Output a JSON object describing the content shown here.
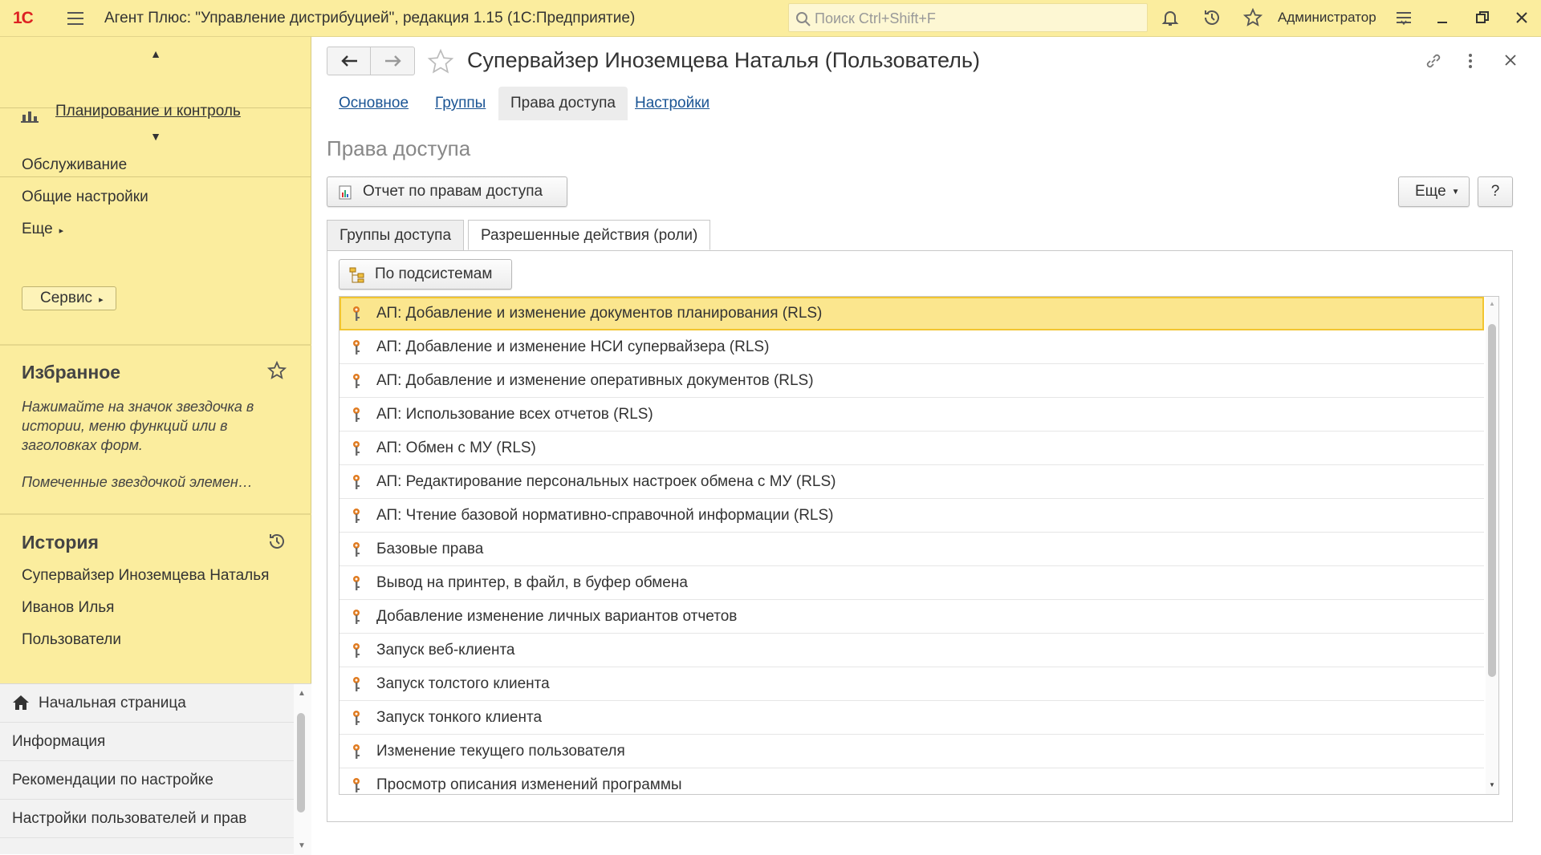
{
  "titlebar": {
    "logo": "1С",
    "app_title": "Агент Плюс: \"Управление дистрибуцией\", редакция 1.15  (1С:Предприятие)",
    "search_placeholder": "Поиск Ctrl+Shift+F",
    "user": "Администратор"
  },
  "sidebar": {
    "sections": [
      {
        "label": "Планирование и контроль"
      }
    ],
    "menu": {
      "service": "Обслуживание",
      "general_settings": "Общие настройки",
      "more": "Еще",
      "servis_button": "Сервис"
    },
    "favorites": {
      "title": "Избранное",
      "hint": "Нажимайте на значок звездочка в истории, меню функций или в заголовках форм.",
      "marked": "Помеченные звездочкой элемен…"
    },
    "history": {
      "title": "История",
      "items": [
        "Супервайзер Иноземцева Наталья",
        "Иванов Илья",
        "Пользователи"
      ]
    },
    "nav": [
      "Начальная страница",
      "Информация",
      "Рекомендации по настройке",
      "Настройки пользователей и прав"
    ]
  },
  "form": {
    "title": "Супервайзер Иноземцева Наталья (Пользователь)",
    "tabs": [
      {
        "label": "Основное",
        "active": false
      },
      {
        "label": "Группы",
        "active": false
      },
      {
        "label": "Права доступа",
        "active": true
      },
      {
        "label": "Настройки",
        "active": false
      }
    ],
    "page_title": "Права доступа",
    "report_button": "Отчет по правам доступа",
    "more_button": "Еще",
    "help_button": "?",
    "panel_tabs": [
      {
        "label": "Группы доступа",
        "active": false
      },
      {
        "label": "Разрешенные действия (роли)",
        "active": true
      }
    ],
    "by_subsystems_button": "По подсистемам",
    "roles": [
      "АП: Добавление и изменение документов планирования (RLS)",
      "АП: Добавление и изменение НСИ супервайзера (RLS)",
      "АП: Добавление и изменение оперативных документов (RLS)",
      "АП: Использование всех отчетов (RLS)",
      "АП: Обмен с МУ (RLS)",
      "АП: Редактирование персональных настроек обмена с МУ (RLS)",
      "АП: Чтение базовой нормативно-справочной информации (RLS)",
      "Базовые права",
      "Вывод на принтер, в файл, в буфер обмена",
      "Добавление изменение личных вариантов отчетов",
      "Запуск веб-клиента",
      "Запуск толстого клиента",
      "Запуск тонкого клиента",
      "Изменение текущего пользователя",
      "Просмотр описания изменений программы"
    ],
    "selected_role_index": 0
  },
  "colors": {
    "titlebar": "#fbed9e",
    "sidebar": "#fbed9e",
    "selection": "#fbe68e",
    "link": "#1a5494",
    "logo": "#dd2222",
    "key_icon": "#e07b20"
  },
  "icons": [
    "burger-icon",
    "search-icon",
    "bell-icon",
    "history-icon",
    "star-icon",
    "settings-lines-icon",
    "minimize-icon",
    "restore-icon",
    "close-icon",
    "bar-chart-icon",
    "back-arrow-icon",
    "forward-arrow-icon",
    "link-icon",
    "kebab-icon",
    "report-icon",
    "hierarchy-icon",
    "key-icon",
    "home-icon"
  ]
}
